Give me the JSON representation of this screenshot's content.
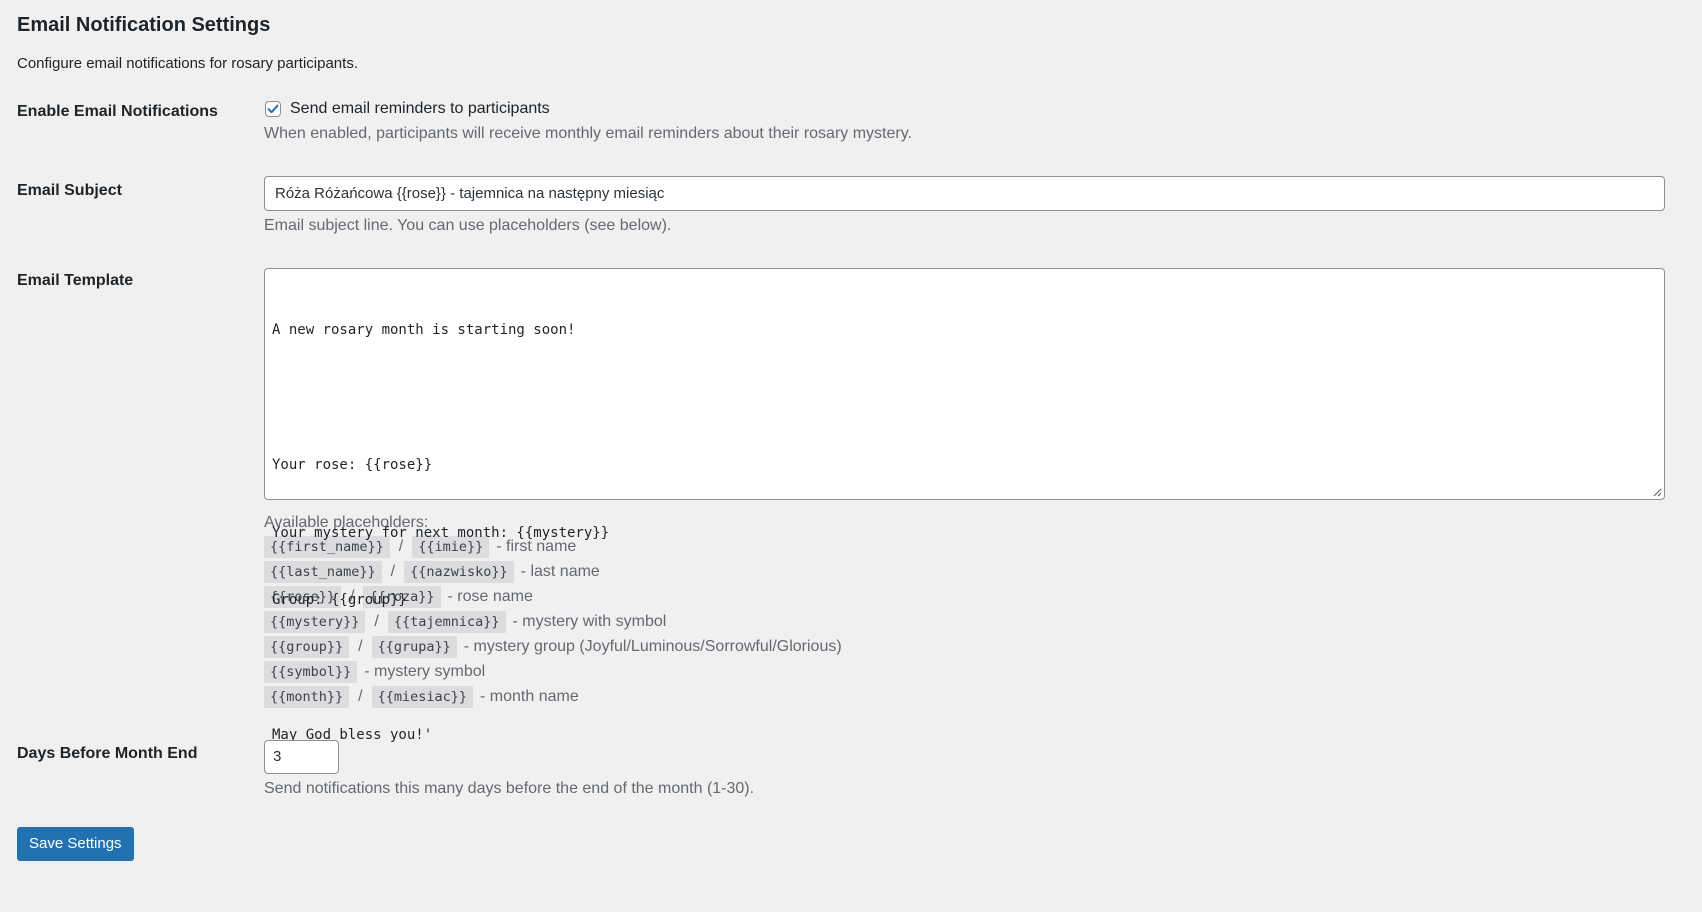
{
  "page": {
    "title": "Email Notification Settings",
    "intro": "Configure email notifications for rosary participants."
  },
  "enable": {
    "label": "Enable Email Notifications",
    "checkbox_label": "Send email reminders to participants",
    "checked": true,
    "description": "When enabled, participants will receive monthly email reminders about their rosary mystery."
  },
  "subject": {
    "label": "Email Subject",
    "value": "Róża Różańcowa {{rose}} - tajemnica na następny miesiąc",
    "description": "Email subject line. You can use placeholders (see below)."
  },
  "template": {
    "label": "Email Template",
    "lines": [
      "A new rosary month is starting soon!",
      "",
      "Your rose: {{rose}}",
      "Your mystery for next month: {{mystery}}",
      "Group: {{group}}",
      "",
      "May God bless you!'"
    ]
  },
  "placeholders": {
    "heading": "Available placeholders:",
    "items": [
      {
        "codes": [
          "{{first_name}}",
          "{{imie}}"
        ],
        "desc": "- first name"
      },
      {
        "codes": [
          "{{last_name}}",
          "{{nazwisko}}"
        ],
        "desc": "- last name"
      },
      {
        "codes": [
          "{{rose}}",
          "{{roza}}"
        ],
        "desc": "- rose name"
      },
      {
        "codes": [
          "{{mystery}}",
          "{{tajemnica}}"
        ],
        "desc": "- mystery with symbol"
      },
      {
        "codes": [
          "{{group}}",
          "{{grupa}}"
        ],
        "desc": "- mystery group (Joyful/Luminous/Sorrowful/Glorious)"
      },
      {
        "codes": [
          "{{symbol}}"
        ],
        "desc": "- mystery symbol"
      },
      {
        "codes": [
          "{{month}}",
          "{{miesiac}}"
        ],
        "desc": "- month name"
      }
    ],
    "separator": "/"
  },
  "days": {
    "label": "Days Before Month End",
    "value": "3",
    "description": "Send notifications this many days before the end of the month (1-30)."
  },
  "actions": {
    "save_label": "Save Settings"
  },
  "colors": {
    "accent": "#2271b1",
    "background": "#f0f0f1",
    "muted_text": "#646970"
  }
}
